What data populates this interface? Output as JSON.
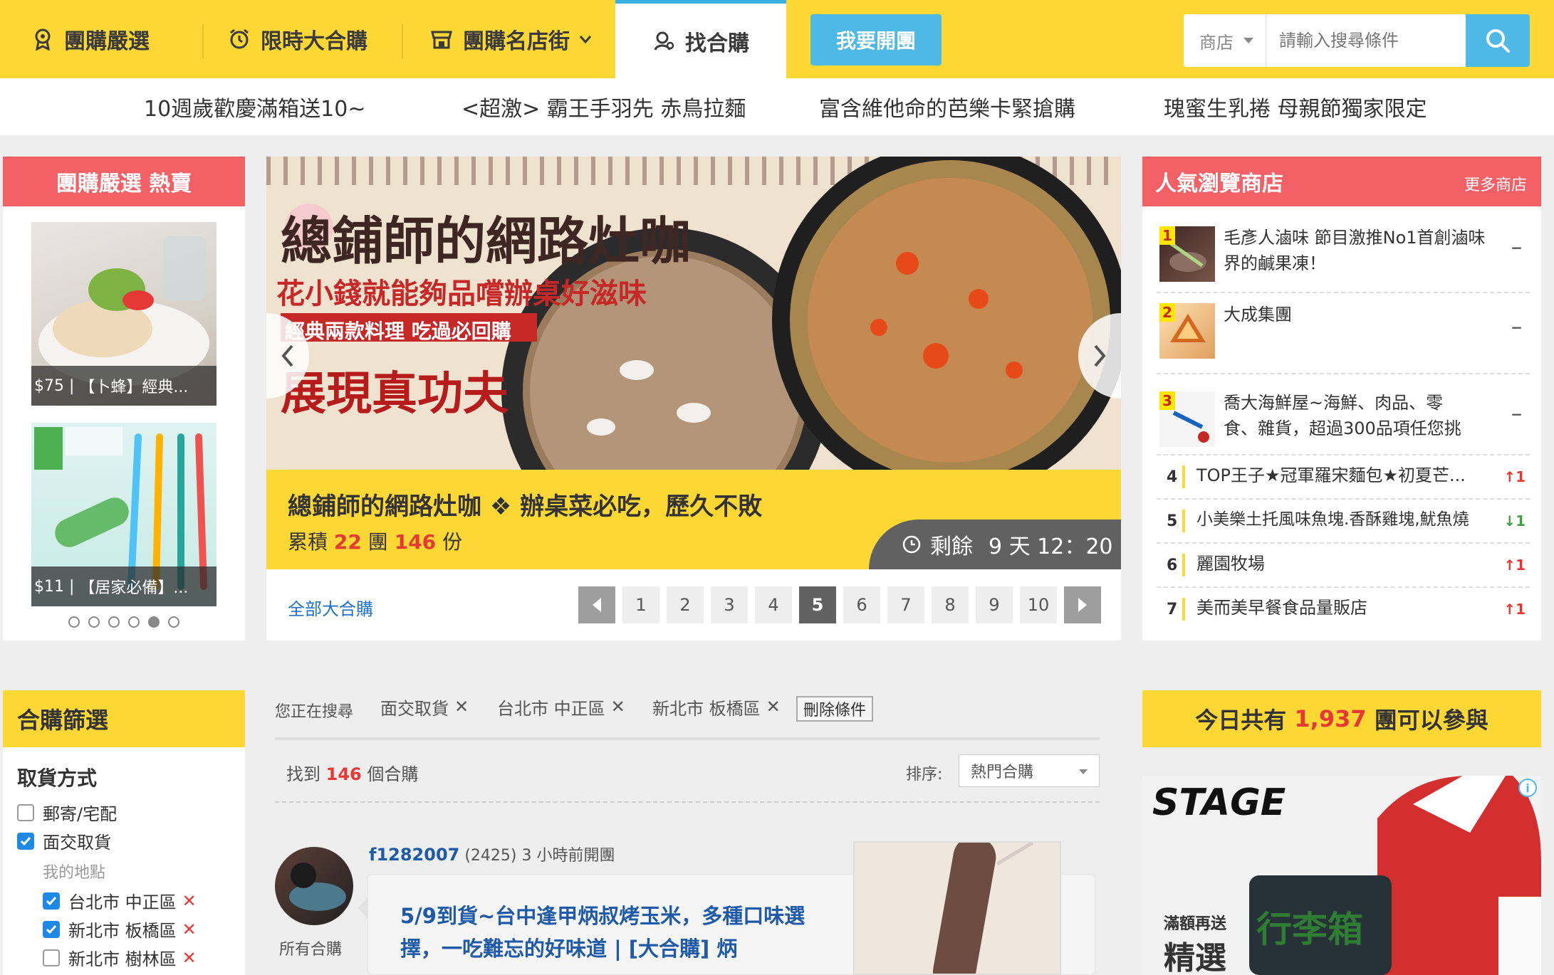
{
  "nav": {
    "items": [
      {
        "label": "團購嚴選"
      },
      {
        "label": "限時大合購"
      },
      {
        "label": "團購名店街"
      },
      {
        "label": "找合購"
      }
    ],
    "open_label": "我要開團",
    "search": {
      "category": "商店",
      "placeholder": "請輸入搜尋條件"
    }
  },
  "marquee": [
    "10週歲歡慶滿箱送10~",
    "<超激> 霸王手羽先 赤鳥拉麵",
    "富含維他命的芭樂卡緊搶購",
    "瑰蜜生乳捲 母親節獨家限定"
  ],
  "hot": {
    "title": "團購嚴選 熱賣",
    "items": [
      {
        "price": "$75",
        "name": "【卜蜂】經典..."
      },
      {
        "price": "$11",
        "name": "【居家必備】..."
      }
    ],
    "dots": 6,
    "active_dot": 4
  },
  "banner": {
    "art_title": "總鋪師的網路灶咖",
    "art_subtitle": "花小錢就能夠品嚐辦桌好滋味",
    "art_tag": "經典兩款料理 吃過必回購",
    "art_slogan": "展現真功夫",
    "title": "總鋪師的網路灶咖 ❖ 辦桌菜必吃，歷久不敗",
    "stats_prefix": "累積",
    "groups": "22",
    "groups_unit": "團",
    "portions": "146",
    "portions_unit": "份",
    "remaining_label": "剩餘",
    "remaining_time": "9 天 12：20",
    "all_link": "全部大合購",
    "pages": [
      "1",
      "2",
      "3",
      "4",
      "5",
      "6",
      "7",
      "8",
      "9",
      "10"
    ],
    "current_page": "5"
  },
  "popular": {
    "title": "人氣瀏覽商店",
    "more": "更多商店",
    "top": [
      {
        "rank": "1",
        "name": "毛彥人滷味 節目激推No1首創滷味界的鹹果凍！",
        "trend": "−"
      },
      {
        "rank": "2",
        "name": "大成集團",
        "trend": "−"
      },
      {
        "rank": "3",
        "name": "喬大海鮮屋~海鮮、肉品、零食、雜貨，超過300品項任您挑",
        "trend": "−"
      }
    ],
    "rest": [
      {
        "rank": "4",
        "name": "TOP王子★冠軍羅宋麵包★初夏芒...",
        "trend": "↑1",
        "dir": "up"
      },
      {
        "rank": "5",
        "name": "小美樂土托風味魚塊.香酥雞塊,魷魚燒",
        "trend": "↓1",
        "dir": "down"
      },
      {
        "rank": "6",
        "name": "麗園牧場",
        "trend": "↑1",
        "dir": "up"
      },
      {
        "rank": "7",
        "name": "美而美早餐食品量販店",
        "trend": "↑1",
        "dir": "up"
      }
    ]
  },
  "filter": {
    "title": "合購篩選",
    "section": "取貨方式",
    "options": [
      {
        "label": "郵寄/宅配",
        "checked": false
      },
      {
        "label": "面交取貨",
        "checked": true
      }
    ],
    "places_label": "我的地點",
    "places": [
      {
        "label": "台北市 中正區",
        "checked": true
      },
      {
        "label": "新北市 板橋區",
        "checked": true
      },
      {
        "label": "新北市 樹林區",
        "checked": false
      }
    ]
  },
  "results": {
    "searching_label": "您正在搜尋",
    "chips": [
      "面交取貨",
      "台北市 中正區",
      "新北市 板橋區"
    ],
    "clear_label": "刪除條件",
    "found_prefix": "找到",
    "found_count": "146",
    "found_suffix": "個合購",
    "sort_label": "排序:",
    "sort_value": "熱門合購",
    "item": {
      "user": "f1282007",
      "score": "(2425)",
      "time": "3 小時前開團",
      "all_label": "所有合購",
      "title": "5/9到貨~台中逢甲炳叔烤玉米，多種口味選擇，一吃難忘的好味道 | [大合購] 炳"
    }
  },
  "today": {
    "prefix": "今日共有",
    "count": "1,937",
    "suffix": "團可以參與"
  },
  "ad": {
    "brand": "STAGE",
    "line1": "滿額再送",
    "line2": "精選",
    "product": "行李箱"
  },
  "colors": {
    "brand_yellow": "#fdd835",
    "accent_blue": "#4fb9e6",
    "hot_red": "#f36065",
    "count_red": "#e53935"
  }
}
